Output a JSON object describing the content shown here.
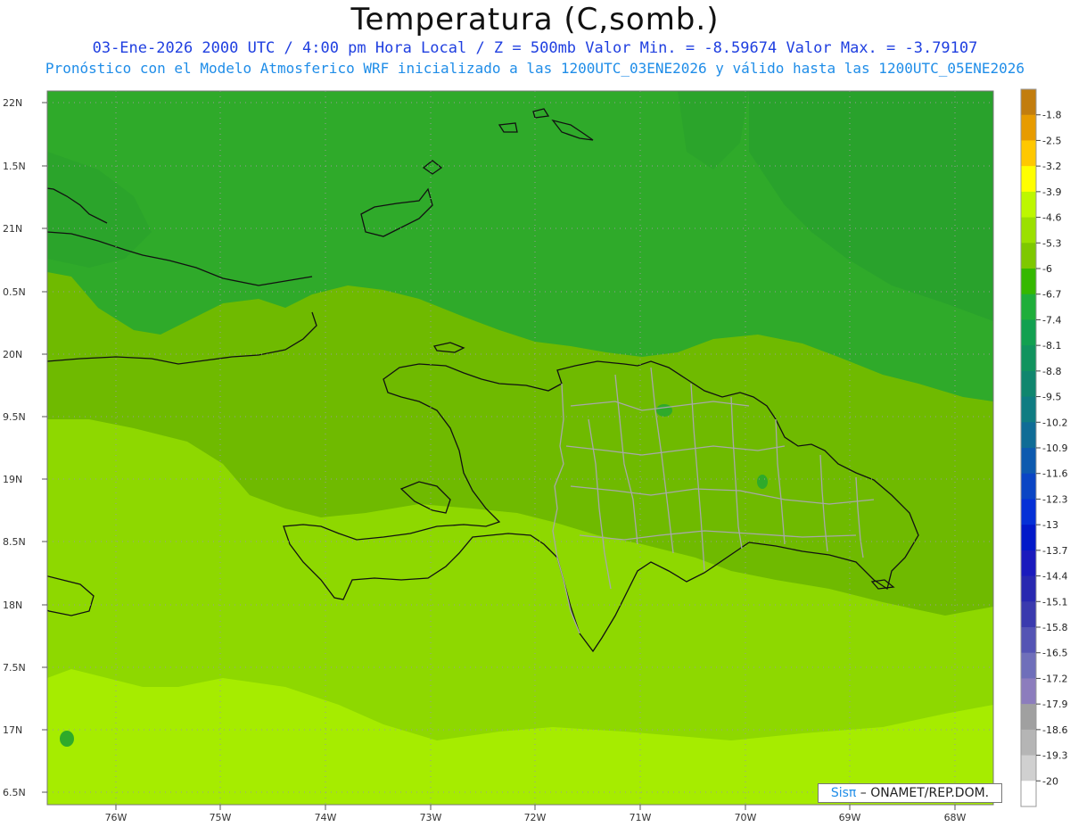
{
  "header": {
    "title": "Temperatura (C,somb.)",
    "line1": "03-Ene-2026  2000 UTC / 4:00 pm Hora Local / Z = 500mb  Valor Min. = -8.59674  Valor Max. = -3.79107",
    "line2": "Pronóstico con el Modelo Atmosferico WRF inicializado a las 1200UTC_03ENE2026 y válido hasta las  1200UTC_05ENE2026"
  },
  "map": {
    "lat_labels": [
      "22N",
      "1.5N",
      "21N",
      "0.5N",
      "20N",
      "9.5N",
      "19N",
      "8.5N",
      "18N",
      "7.5N",
      "17N",
      "6.5N"
    ],
    "lon_labels": [
      "76W",
      "75W",
      "74W",
      "73W",
      "72W",
      "71W",
      "70W",
      "69W",
      "68W"
    ]
  },
  "colorbar": {
    "labels": [
      "-1.8",
      "-2.5",
      "-3.2",
      "-3.9",
      "-4.6",
      "-5.3",
      "-6",
      "-6.7",
      "-7.4",
      "-8.1",
      "-8.8",
      "-9.5",
      "-10.2",
      "-10.9",
      "-11.6",
      "-12.3",
      "-13",
      "-13.7",
      "-14.4",
      "-15.1",
      "-15.8",
      "-16.5",
      "-17.2",
      "-17.9",
      "-18.6",
      "-19.3",
      "-20"
    ],
    "colors": [
      "#c27d0e",
      "#e79b00",
      "#ffc800",
      "#ffff00",
      "#bdf700",
      "#9be000",
      "#7ec800",
      "#35b800",
      "#1fae3a",
      "#12a050",
      "#11935e",
      "#10866e",
      "#0f7c82",
      "#0f6c96",
      "#0d5aaf",
      "#0a45c4",
      "#0530d6",
      "#0219c9",
      "#1a1abd",
      "#2828b0",
      "#3a3aae",
      "#5454b4",
      "#6f6fba",
      "#8c7dbd",
      "#a0a0a0",
      "#b5b5b5",
      "#d0d0d0",
      "#ffffff"
    ]
  },
  "credit": {
    "brand": "Sisπ",
    "text": " – ONAMET/REP.DOM."
  }
}
